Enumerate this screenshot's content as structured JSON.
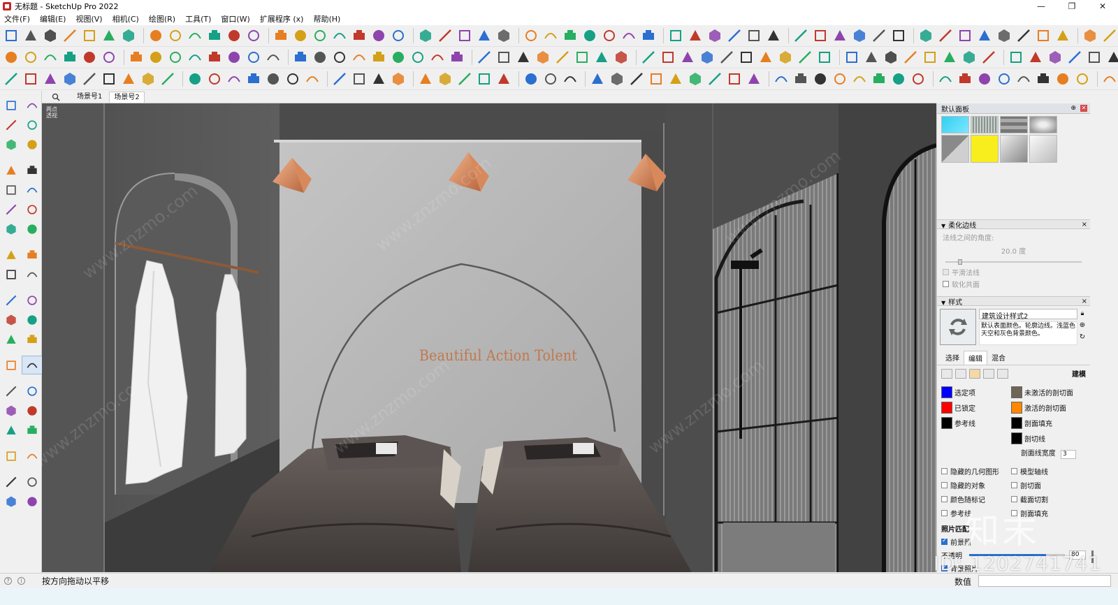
{
  "window": {
    "title": "无标题 - SketchUp Pro 2022",
    "minimize": "—",
    "maximize": "❐",
    "close": "✕"
  },
  "menu": [
    "文件(F)",
    "编辑(E)",
    "视图(V)",
    "相机(C)",
    "绘图(R)",
    "工具(T)",
    "窗口(W)",
    "扩展程序 (x)",
    "帮助(H)"
  ],
  "scenes": {
    "tabs": [
      "场景号1",
      "场景号2"
    ],
    "active": 1
  },
  "viewport": {
    "camera_mode_line1": "两点",
    "camera_mode_line2": "透视",
    "wall_text": "Beautiful Action Tolent",
    "watermark": "www.znzmo.com",
    "watermark_brand": "知末",
    "watermark_id": "ID: 1202741741"
  },
  "tray": {
    "default_panel_title": "默认面板",
    "soften": {
      "title": "柔化边线",
      "angle_label": "法线之间的角度:",
      "angle_value": "20.0 度",
      "smooth_normals": "平滑法线",
      "soften_coplanar": "软化共面"
    },
    "styles": {
      "title": "样式",
      "style_name": "建筑设计样式2",
      "description": "默认表面颜色。轮廓边线。浅蓝色天空和灰色背景颜色。",
      "tabs": [
        "选择",
        "编辑",
        "混合"
      ],
      "active_tab": 1,
      "edit_section_label": "建模",
      "colors": [
        {
          "label": "选定项",
          "color": "#0000ff"
        },
        {
          "label": "未激活的剖切面",
          "color": "#6e6557"
        },
        {
          "label": "已锁定",
          "color": "#ff0000"
        },
        {
          "label": "激活的剖切面",
          "color": "#ff8800"
        },
        {
          "label": "参考线",
          "color": "#000000"
        },
        {
          "label": "剖面填充",
          "color": "#000000"
        },
        {
          "label": "",
          "color": ""
        },
        {
          "label": "剖切线",
          "color": "#000000"
        }
      ],
      "section_width_label": "剖面线宽度",
      "section_width_value": "3",
      "checkboxes": [
        {
          "label": "隐藏的几何图形",
          "checked": false
        },
        {
          "label": "模型轴线",
          "checked": false
        },
        {
          "label": "隐藏的对象",
          "checked": false
        },
        {
          "label": "剖切面",
          "checked": false
        },
        {
          "label": "颜色随标记",
          "checked": false
        },
        {
          "label": "截面切割",
          "checked": false
        },
        {
          "label": "参考线",
          "checked": false
        },
        {
          "label": "剖面填充",
          "checked": false
        }
      ],
      "photo_title": "照片匹配",
      "foreground": "前景照",
      "opacity_label": "不透明",
      "opacity_value": "80",
      "background_photo": "背景照片"
    }
  },
  "status": {
    "message": "按方向拖动以平移",
    "vcb_label": "数值",
    "vcb_value": ""
  }
}
